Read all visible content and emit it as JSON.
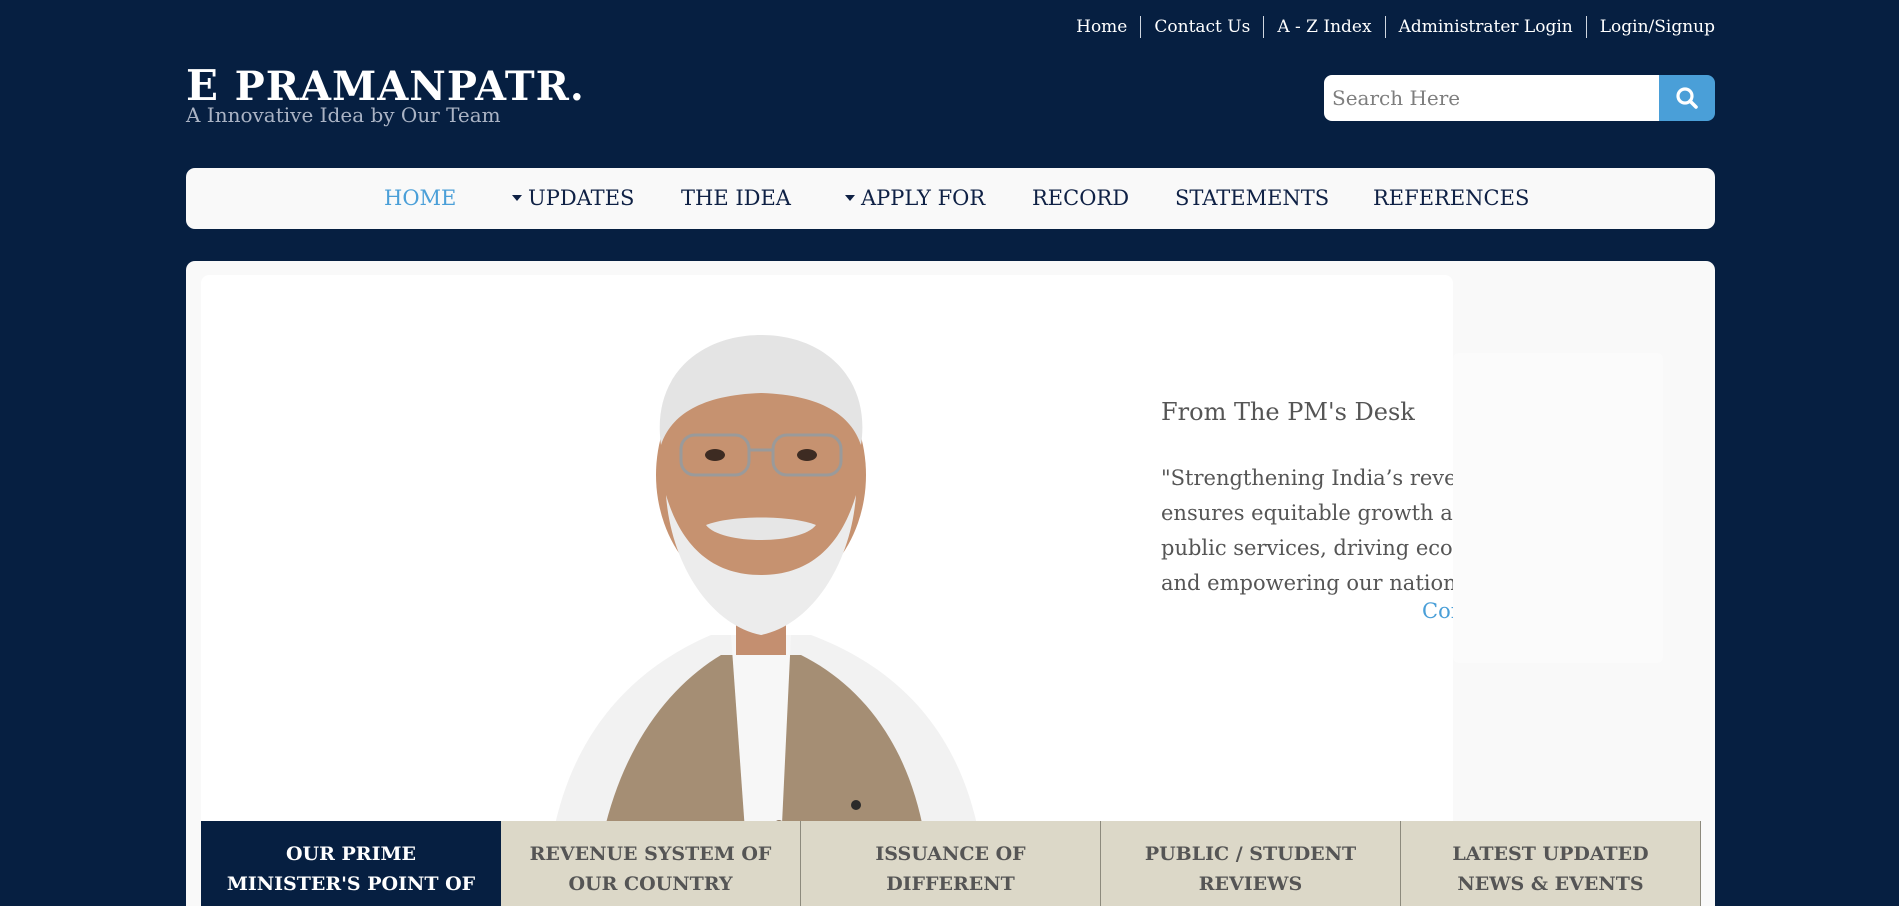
{
  "top_links": [
    "Home",
    "Contact Us",
    "A - Z Index",
    "Administrater Login",
    "Login/Signup"
  ],
  "logo": {
    "initial": "E",
    "rest": "PRAMANPATR.",
    "tagline": "A Innovative Idea by Our Team"
  },
  "search": {
    "placeholder": "Search Here",
    "icon": "search-icon"
  },
  "nav": {
    "items": [
      {
        "label": "HOME",
        "active": true,
        "dropdown": false
      },
      {
        "label": "UPDATES",
        "active": false,
        "dropdown": true
      },
      {
        "label": "THE IDEA",
        "active": false,
        "dropdown": false
      },
      {
        "label": "APPLY FOR",
        "active": false,
        "dropdown": true
      },
      {
        "label": "RECORD",
        "active": false,
        "dropdown": false
      },
      {
        "label": "STATEMENTS",
        "active": false,
        "dropdown": false
      },
      {
        "label": "REFERENCES",
        "active": false,
        "dropdown": false
      }
    ]
  },
  "slide": {
    "heading": "From The PM's Desk",
    "quote": "\"Strengthening India’s revenue systems ensures equitable growth and efficient public services, driving economic progress and empowering our nation’s future.\"",
    "continue_label": "Continue Reading »"
  },
  "tabs": [
    {
      "label": "OUR PRIME MINISTER'S POINT OF VIEW",
      "active": true
    },
    {
      "label": "REVENUE SYSTEM OF OUR COUNTRY",
      "active": false
    },
    {
      "label": "ISSUANCE OF DIFFERENT CERTIFICATES",
      "active": false
    },
    {
      "label": "PUBLIC / STUDENT REVIEWS",
      "active": false
    },
    {
      "label": "LATEST UPDATED NEWS & EVENTS",
      "active": false
    }
  ],
  "colors": {
    "background": "#061f41",
    "accent": "#4a9fd8",
    "panel": "#f9f9f9",
    "tab": "#dcd8c8"
  }
}
